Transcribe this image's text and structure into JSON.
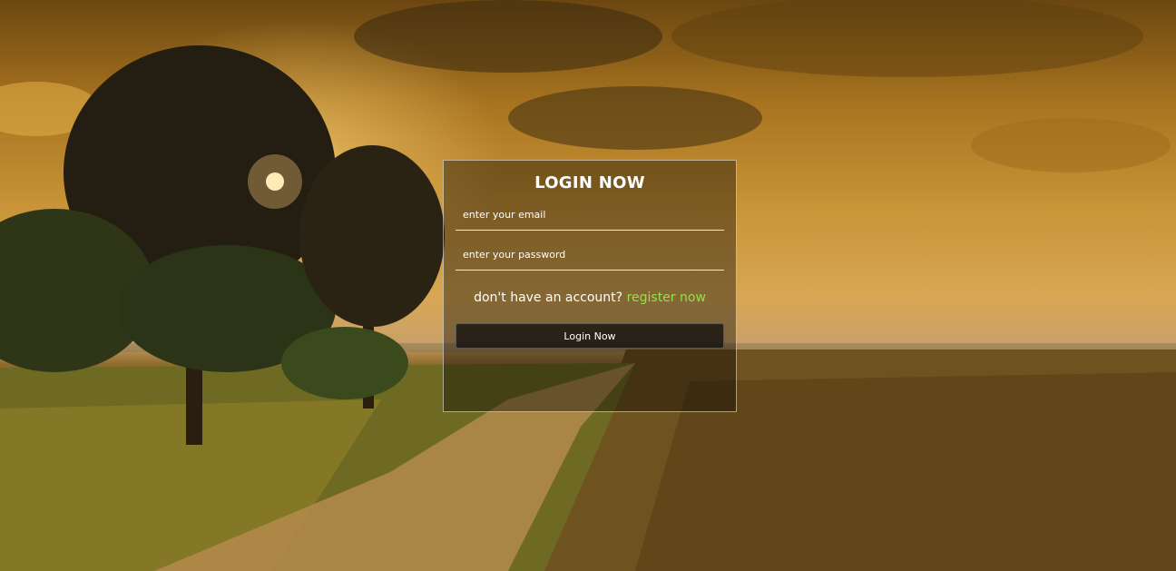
{
  "login": {
    "title": "LOGIN NOW",
    "email_placeholder": "enter your email",
    "password_placeholder": "enter your password",
    "register_prompt": "don't have an account?",
    "register_link": "register now",
    "submit_label": "Login Now"
  },
  "colors": {
    "link": "#8fe24a",
    "card_border": "#d9d9d9",
    "button_bg": "#141414"
  }
}
